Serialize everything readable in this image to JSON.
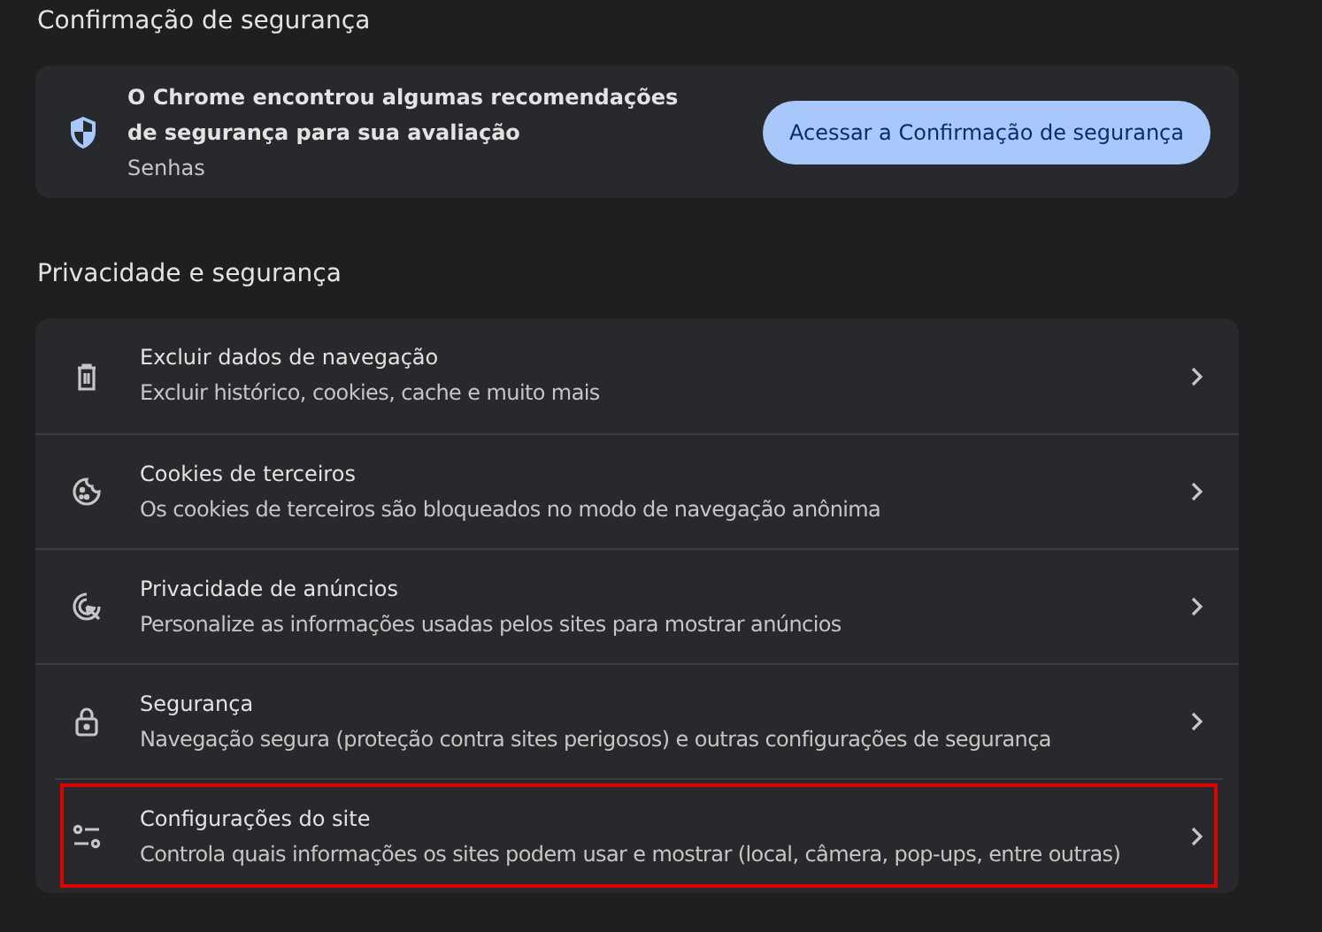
{
  "safety_check": {
    "heading": "Confirmação de segurança",
    "message": "O Chrome encontrou algumas recomendações de segurança para sua avaliação",
    "detail": "Senhas",
    "button": "Acessar a Confirmação de segurança"
  },
  "privacy": {
    "heading": "Privacidade e segurança",
    "items": [
      {
        "title": "Excluir dados de navegação",
        "description": "Excluir histórico, cookies, cache e muito mais",
        "highlighted": false
      },
      {
        "title": "Cookies de terceiros",
        "description": "Os cookies de terceiros são bloqueados no modo de navegação anônima",
        "highlighted": false
      },
      {
        "title": "Privacidade de anúncios",
        "description": "Personalize as informações usadas pelos sites para mostrar anúncios",
        "highlighted": false
      },
      {
        "title": "Segurança",
        "description": "Navegação segura (proteção contra sites perigosos) e outras configurações de segurança",
        "highlighted": false
      },
      {
        "title": "Configurações do site",
        "description": "Controla quais informações os sites podem usar e mostrar (local, câmera, pop-ups, entre outras)",
        "highlighted": true
      }
    ]
  }
}
